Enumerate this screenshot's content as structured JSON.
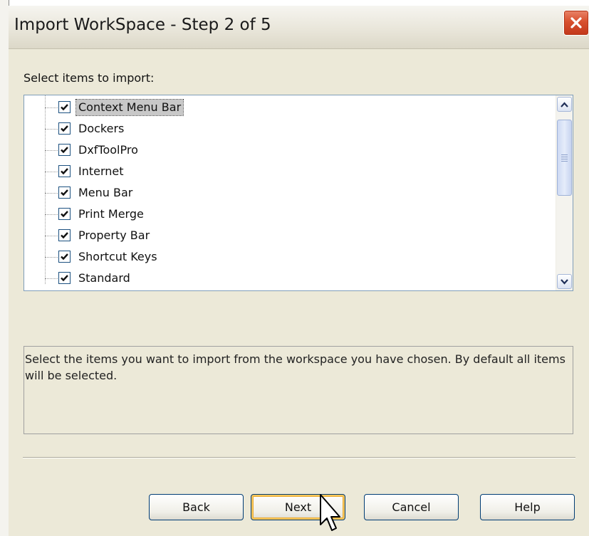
{
  "window": {
    "title": "Import WorkSpace - Step 2 of 5"
  },
  "prompt": "Select items to import:",
  "items": [
    {
      "label": "Context Menu Bar",
      "checked": true,
      "selected": true
    },
    {
      "label": "Dockers",
      "checked": true,
      "selected": false
    },
    {
      "label": "DxfToolPro",
      "checked": true,
      "selected": false
    },
    {
      "label": "Internet",
      "checked": true,
      "selected": false
    },
    {
      "label": "Menu Bar",
      "checked": true,
      "selected": false
    },
    {
      "label": "Print Merge",
      "checked": true,
      "selected": false
    },
    {
      "label": "Property Bar",
      "checked": true,
      "selected": false
    },
    {
      "label": "Shortcut Keys",
      "checked": true,
      "selected": false
    },
    {
      "label": "Standard",
      "checked": true,
      "selected": false
    }
  ],
  "description": "Select the items you want to import from the workspace you have chosen. By default all items will be selected.",
  "buttons": {
    "back": "Back",
    "next": "Next",
    "cancel": "Cancel",
    "help": "Help"
  },
  "colors": {
    "close_button": "#d8502e",
    "list_border": "#7f9db9",
    "selection": "#c8c8c8",
    "default_button_focus": "#f7c65b"
  }
}
